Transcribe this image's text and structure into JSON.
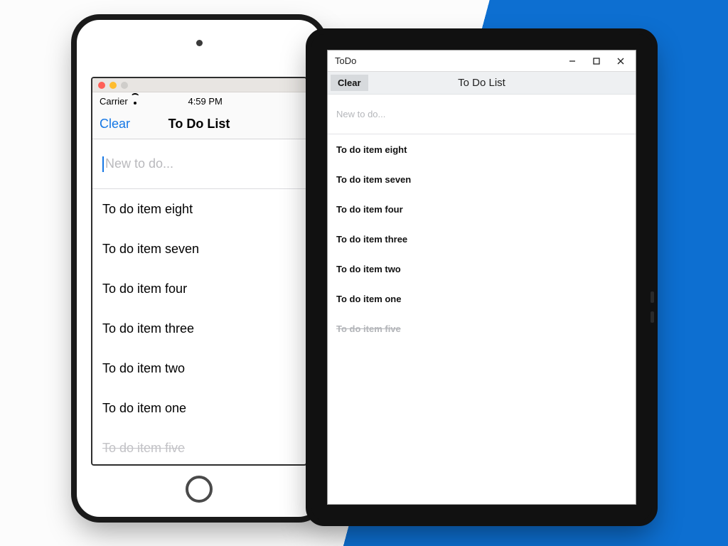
{
  "ios": {
    "carrier": "Carrier",
    "time": "4:59 PM",
    "clear_label": "Clear",
    "title": "To Do List",
    "input_placeholder": "New to do...",
    "items": [
      {
        "label": "To do item eight",
        "done": false
      },
      {
        "label": "To do item seven",
        "done": false
      },
      {
        "label": "To do item four",
        "done": false
      },
      {
        "label": "To do item three",
        "done": false
      },
      {
        "label": "To do item two",
        "done": false
      },
      {
        "label": "To do item one",
        "done": false
      },
      {
        "label": "To do item five",
        "done": true
      }
    ]
  },
  "win": {
    "window_title": "ToDo",
    "clear_label": "Clear",
    "title": "To Do List",
    "input_placeholder": "New to do...",
    "items": [
      {
        "label": "To do item eight",
        "done": false
      },
      {
        "label": "To do item seven",
        "done": false
      },
      {
        "label": "To do item four",
        "done": false
      },
      {
        "label": "To do item three",
        "done": false
      },
      {
        "label": "To do item two",
        "done": false
      },
      {
        "label": "To do item one",
        "done": false
      },
      {
        "label": "To do item five",
        "done": true
      }
    ]
  }
}
